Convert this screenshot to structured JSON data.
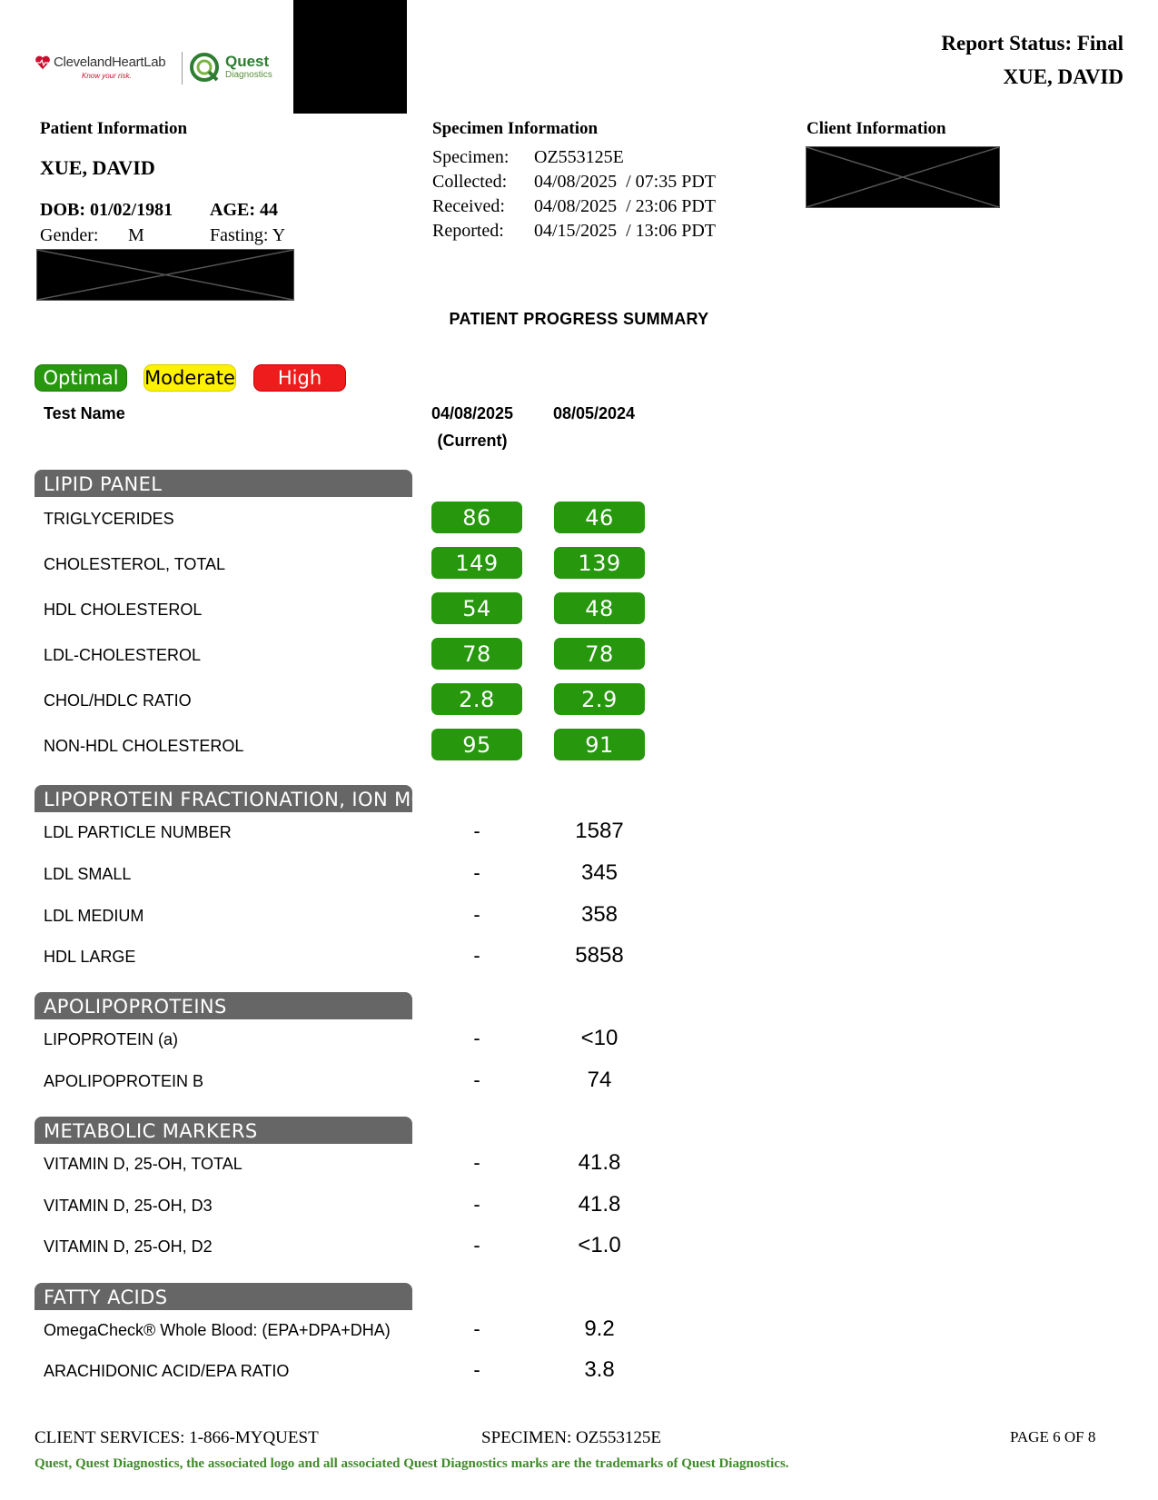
{
  "header": {
    "report_status": "Report Status: Final",
    "patient_name": "XUE, DAVID",
    "logo_cleveland": "ClevelandHeartLab",
    "logo_cleveland_tag": "Know your risk.",
    "logo_quest": "Quest",
    "logo_quest_sub": "Diagnostics"
  },
  "patient": {
    "section_title": "Patient Information",
    "name": "XUE, DAVID",
    "dob": "DOB: 01/02/1981",
    "age": "AGE: 44",
    "gender_label": "Gender:",
    "gender_value": "M",
    "fasting": "Fasting: Y"
  },
  "specimen": {
    "section_title": "Specimen Information",
    "rows": [
      {
        "label": "Specimen:",
        "value": "OZ553125E"
      },
      {
        "label": "Collected:",
        "value": "04/08/2025  / 07:35 PDT"
      },
      {
        "label": "Received:",
        "value": "04/08/2025  / 23:06 PDT"
      },
      {
        "label": "Reported:",
        "value": "04/15/2025  / 13:06 PDT"
      }
    ]
  },
  "client": {
    "section_title": "Client Information"
  },
  "summary": {
    "title": "PATIENT PROGRESS SUMMARY",
    "legend": {
      "optimal": "Optimal",
      "moderate": "Moderate",
      "high": "High"
    },
    "colors": {
      "optimal": "#27970e",
      "moderate": "#fff200",
      "high": "#ee1c1c",
      "section_bar": "#666666"
    },
    "col_test": "Test Name",
    "col_current_date": "04/08/2025",
    "col_current_tag": "(Current)",
    "col_prior_date": "08/05/2024"
  },
  "sections": [
    {
      "title": "LIPID PANEL",
      "rows": [
        {
          "name": "TRIGLYCERIDES",
          "current": "86",
          "prior": "46",
          "status": "optimal"
        },
        {
          "name": "CHOLESTEROL, TOTAL",
          "current": "149",
          "prior": "139",
          "status": "optimal"
        },
        {
          "name": "HDL CHOLESTEROL",
          "current": "54",
          "prior": "48",
          "status": "optimal"
        },
        {
          "name": "LDL-CHOLESTEROL",
          "current": "78",
          "prior": "78",
          "status": "optimal"
        },
        {
          "name": "CHOL/HDLC RATIO",
          "current": "2.8",
          "prior": "2.9",
          "status": "optimal"
        },
        {
          "name": "NON-HDL CHOLESTEROL",
          "current": "95",
          "prior": "91",
          "status": "optimal"
        }
      ]
    },
    {
      "title": "LIPOPROTEIN FRACTIONATION, ION MOBILITY",
      "rows": [
        {
          "name": "LDL PARTICLE NUMBER",
          "current": "-",
          "prior": "1587"
        },
        {
          "name": "LDL SMALL",
          "current": "-",
          "prior": "345"
        },
        {
          "name": "LDL MEDIUM",
          "current": "-",
          "prior": "358"
        },
        {
          "name": "HDL LARGE",
          "current": "-",
          "prior": "5858"
        }
      ]
    },
    {
      "title": "APOLIPOPROTEINS",
      "rows": [
        {
          "name": "LIPOPROTEIN (a)",
          "current": "-",
          "prior": "<10"
        },
        {
          "name": "APOLIPOPROTEIN B",
          "current": "-",
          "prior": "74"
        }
      ]
    },
    {
      "title": "METABOLIC MARKERS",
      "rows": [
        {
          "name": "VITAMIN D, 25-OH, TOTAL",
          "current": "-",
          "prior": "41.8"
        },
        {
          "name": "VITAMIN D, 25-OH, D3",
          "current": "-",
          "prior": "41.8"
        },
        {
          "name": "VITAMIN D, 25-OH, D2",
          "current": "-",
          "prior": "<1.0"
        }
      ]
    },
    {
      "title": "FATTY ACIDS",
      "rows": [
        {
          "name": "OmegaCheck® Whole Blood: (EPA+DPA+DHA)",
          "current": "-",
          "prior": "9.2"
        },
        {
          "name": "ARACHIDONIC ACID/EPA RATIO",
          "current": "-",
          "prior": "3.8"
        }
      ]
    }
  ],
  "footer": {
    "client_services": "CLIENT SERVICES: 1-866-MYQUEST",
    "specimen": "SPECIMEN: OZ553125E",
    "page": "PAGE 6 OF 8",
    "trademark": "Quest, Quest Diagnostics, the associated logo and all associated Quest Diagnostics marks are the trademarks of Quest Diagnostics."
  }
}
